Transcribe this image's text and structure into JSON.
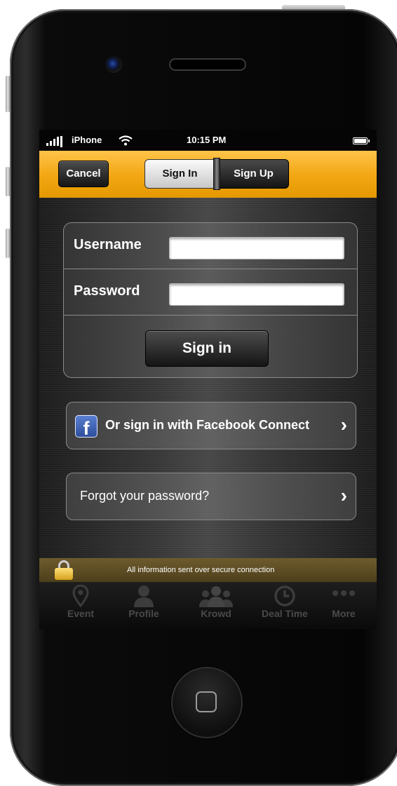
{
  "status_bar": {
    "carrier": "iPhone",
    "time": "10:15 PM"
  },
  "nav": {
    "cancel_label": "Cancel",
    "segments": [
      "Sign In",
      "Sign Up"
    ],
    "selected_segment": "Sign In"
  },
  "login_form": {
    "username_label": "Username",
    "username_value": "",
    "password_label": "Password",
    "password_value": "",
    "submit_label": "Sign in"
  },
  "facebook": {
    "icon_letter": "f",
    "label": "Or sign in with Facebook Connect"
  },
  "forgot": {
    "label": "Forgot your password?"
  },
  "secure_notice": "All information sent over secure connection",
  "tabs": [
    {
      "label": "Event",
      "icon": "location-pin-icon"
    },
    {
      "label": "Profile",
      "icon": "person-icon"
    },
    {
      "label": "Krowd",
      "icon": "group-icon"
    },
    {
      "label": "Deal Time",
      "icon": "clock-icon"
    },
    {
      "label": "More",
      "icon": "more-dots-icon"
    }
  ],
  "colors": {
    "nav_bar": "#f3a816",
    "secure_bar": "#5e4d24",
    "tab_inactive": "#4a4a4a"
  }
}
